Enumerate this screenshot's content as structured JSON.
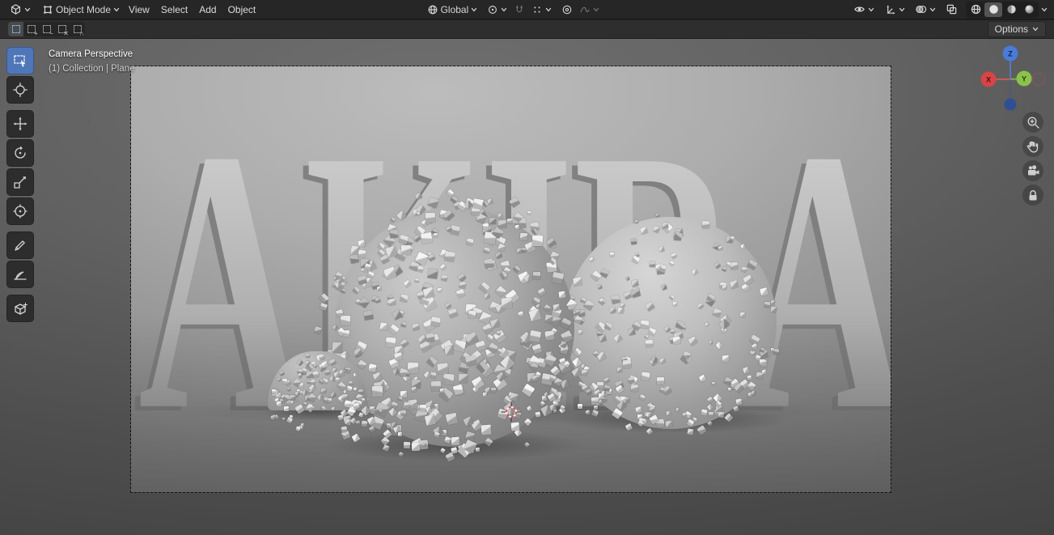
{
  "header": {
    "mode_selector": {
      "label": "Object Mode"
    },
    "menus": [
      {
        "label": "View"
      },
      {
        "label": "Select"
      },
      {
        "label": "Add"
      },
      {
        "label": "Object"
      }
    ],
    "orientation": {
      "label": "Global"
    },
    "shading": {
      "modes": [
        "wireframe",
        "solid",
        "material-preview",
        "rendered"
      ],
      "active": "solid"
    },
    "icons": {
      "editor_type": "3d-viewport-cube",
      "mode": "object-square",
      "snap": "magnet",
      "proportional": "concentric-circles",
      "visibility": "eye",
      "gizmos": "axis-arrows",
      "overlays": "overlapping-circles",
      "xray": "overlapping-squares"
    }
  },
  "tool_settings": {
    "options": {
      "label": "Options"
    },
    "select_modes": [
      {
        "name": "new",
        "active": true
      },
      {
        "name": "extend",
        "active": false
      },
      {
        "name": "subtract",
        "active": false
      },
      {
        "name": "invert",
        "active": false
      },
      {
        "name": "intersect",
        "active": false
      }
    ]
  },
  "toolbar": {
    "tools": [
      "select-box",
      "cursor",
      "move",
      "rotate",
      "scale",
      "transform",
      "annotate",
      "measure",
      "add-cube"
    ],
    "active_tool": "select-box"
  },
  "viewport": {
    "view_label": "Camera Perspective",
    "breadcrumb": "(1) Collection | Plane",
    "scene_text": "AKIRA"
  },
  "nav_gizmo": {
    "x": "X",
    "y": "Y",
    "z": "Z"
  },
  "colors": {
    "accent": "#4f76b8",
    "axis_x": "#d64545",
    "axis_y": "#8bc24a",
    "axis_z": "#4a7bd8",
    "cursor_red": "#d84a3f"
  }
}
